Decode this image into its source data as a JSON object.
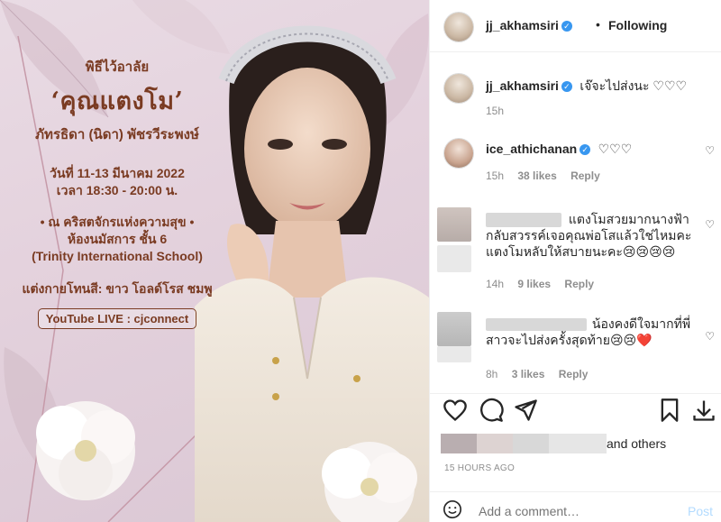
{
  "post": {
    "ceremony": "พิธีไว้อาลัย",
    "name": "‘คุณแตงโม’",
    "fullname": "ภัทรธิดา (นิดา) พัชรวีระพงษ์",
    "date_line": "วันที่ 11-13 มีนาคม 2022",
    "time_line": "เวลา 18:30 - 20:00 น.",
    "venue_line1": "• ณ คริสตจักรแห่งความสุข •",
    "venue_line2": "ห้องนมัสการ ชั้น 6",
    "venue_line3": "(Trinity International School)",
    "dress_code": "แต่งกายโทนสี: ขาว โอลด์โรส ชมพู",
    "live": "YouTube LIVE : cjconnect"
  },
  "header": {
    "username": "jj_akhamsiri",
    "separator": "•",
    "follow_status": "Following"
  },
  "comments": [
    {
      "user": "jj_akhamsiri",
      "text": "เจ๊จะไปส่งนะ ♡♡♡",
      "time": "15h"
    },
    {
      "user": "ice_athichanan",
      "text": "♡♡♡",
      "time": "15h",
      "likes": "38 likes",
      "reply": "Reply"
    },
    {
      "text_line1": "แตงโมสวยมากนางฟ้า",
      "text_line2": "กลับสวรรค์เจอคุณพ่อโสแล้วใช่ไหมคะ",
      "text_line3": "แตงโมหลับให้สบายนะคะ😢😢😢😢",
      "time": "14h",
      "likes": "9 likes",
      "reply": "Reply"
    },
    {
      "text_line1": "น้องคงดีใจมากที่พี่",
      "text_line2": "สาวจะไปส่งครั้งสุดท้าย😢😢❤️",
      "time": "8h",
      "likes": "3 likes",
      "reply": "Reply"
    }
  ],
  "likes": {
    "others": "and others"
  },
  "timestamp": "15 HOURS AGO",
  "add_comment": {
    "placeholder": "Add a comment…",
    "post_label": "Post"
  },
  "colors": {
    "accent": "#3897f0",
    "title_brown": "#7a3b22",
    "muted": "#8e8e8e"
  }
}
